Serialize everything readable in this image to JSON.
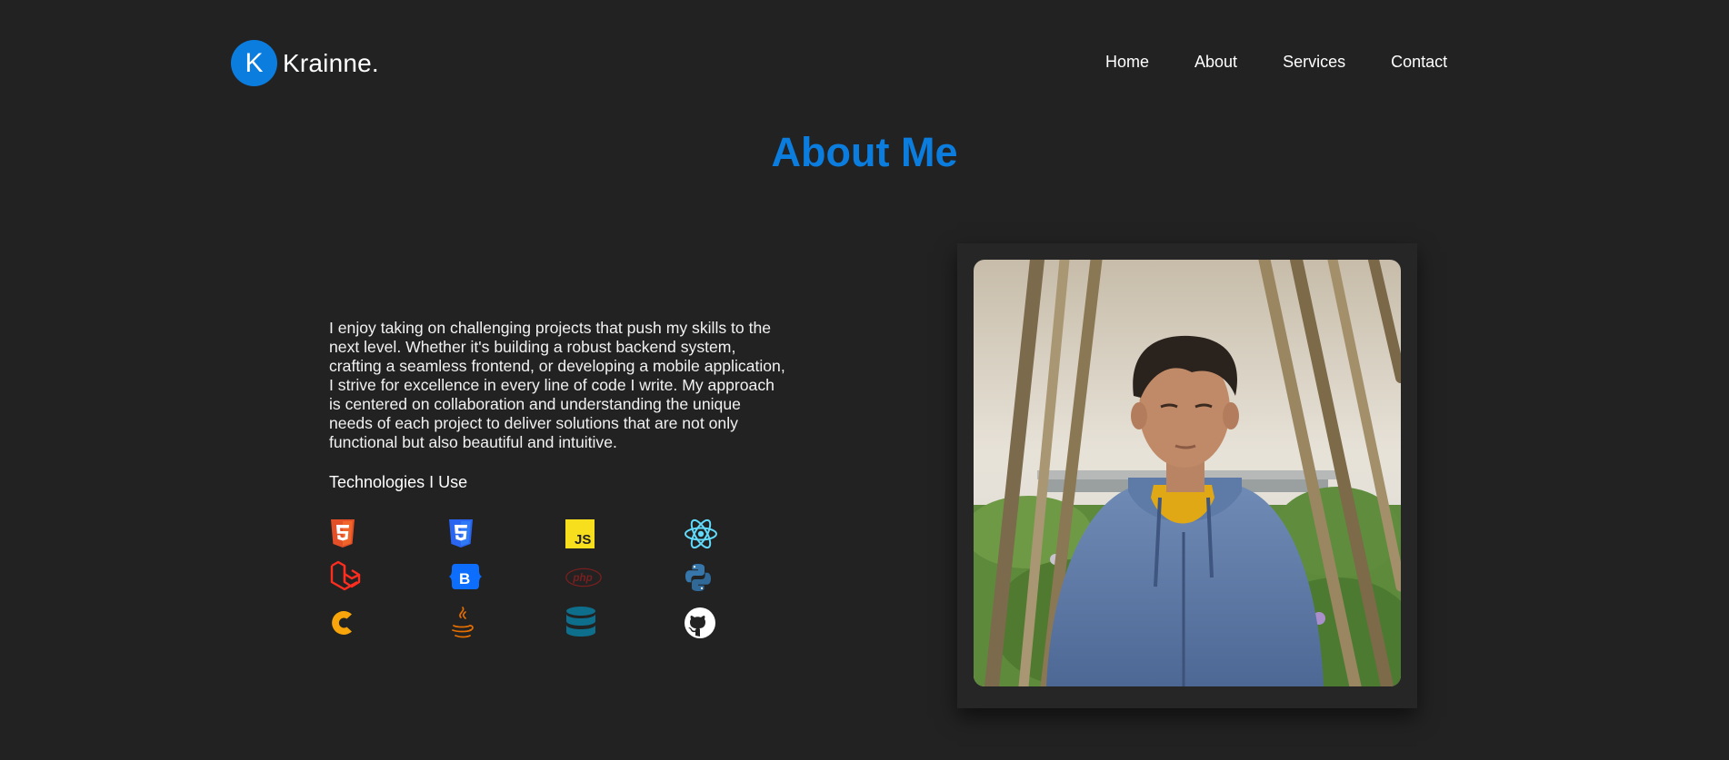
{
  "brand": {
    "initial": "K",
    "name": "Krainne."
  },
  "nav": {
    "items": [
      "Home",
      "About",
      "Services",
      "Contact"
    ]
  },
  "about": {
    "title": "About Me",
    "bio": "I enjoy taking on challenging projects that push my skills to the next level. Whether it's building a robust backend system, crafting a seamless frontend, or developing a mobile application, I strive for excellence in every line of code I write. My approach is centered on collaboration and understanding the unique needs of each project to deliver solutions that are not only functional but also beautiful and intuitive.",
    "tech_heading": "Technologies I Use",
    "technologies": [
      {
        "icon": "html5-icon",
        "color": "#e34f26"
      },
      {
        "icon": "css3-icon",
        "color": "#1572b6"
      },
      {
        "icon": "javascript-icon",
        "color": "#f7df1e"
      },
      {
        "icon": "react-icon",
        "color": "#61dafb"
      },
      {
        "icon": "laravel-icon",
        "color": "#ff2d20"
      },
      {
        "icon": "bootstrap-icon",
        "color": "#0d6efd"
      },
      {
        "icon": "php-icon",
        "color": "#7a1f1f"
      },
      {
        "icon": "python-icon",
        "color": "#3776ab"
      },
      {
        "icon": "codeigniter-icon",
        "color": "#f7a50a"
      },
      {
        "icon": "java-icon",
        "color": "#e76f00"
      },
      {
        "icon": "database-icon",
        "color": "#0e6f8c"
      },
      {
        "icon": "github-icon",
        "color": "#ffffff"
      }
    ]
  },
  "colors": {
    "background": "#222222",
    "accent": "#0b7ddf",
    "text": "#ffffff"
  }
}
